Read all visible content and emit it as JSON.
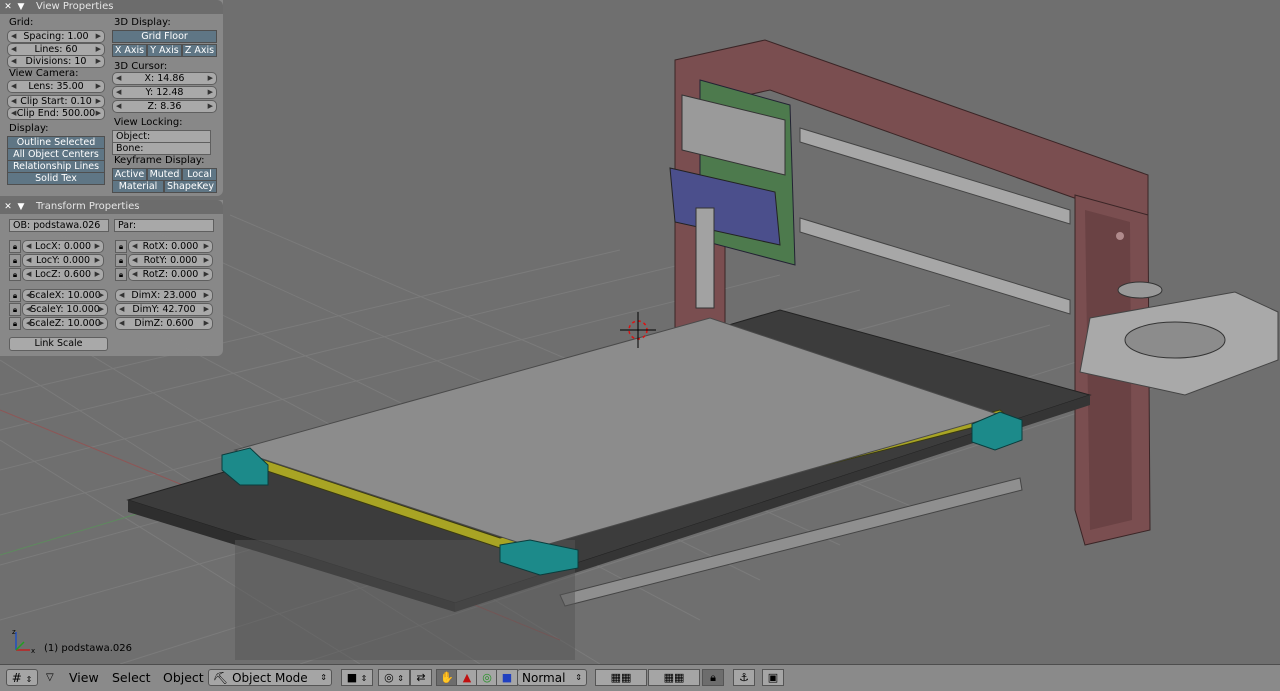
{
  "view_properties": {
    "title": "View Properties",
    "grid": {
      "label": "Grid:",
      "spacing": "Spacing: 1.00",
      "lines": "Lines: 60",
      "divisions": "Divisions: 10"
    },
    "view_camera": {
      "label": "View Camera:",
      "lens": "Lens: 35.00",
      "clip_start": "Clip Start: 0.10",
      "clip_end": "Clip End: 500.00"
    },
    "display": {
      "label": "Display:",
      "items": [
        "Outline Selected",
        "All Object Centers",
        "Relationship Lines",
        "Solid Tex"
      ]
    },
    "display_3d": {
      "label": "3D Display:",
      "grid_floor": "Grid Floor",
      "x_axis": "X Axis",
      "y_axis": "Y Axis",
      "z_axis": "Z Axis"
    },
    "cursor_3d": {
      "label": "3D Cursor:",
      "x": "X: 14.86",
      "y": "Y: 12.48",
      "z": "Z: 8.36"
    },
    "view_locking": {
      "label": "View Locking:",
      "object": "Object:",
      "bone": "Bone:"
    },
    "keyframe_display": {
      "label": "Keyframe Display:",
      "active": "Active",
      "muted": "Muted",
      "local": "Local",
      "material": "Material",
      "shapekey": "ShapeKey"
    }
  },
  "transform_properties": {
    "title": "Transform Properties",
    "object_name": "OB: podstawa.026",
    "parent": "Par:",
    "loc": [
      "LocX: 0.000",
      "LocY: 0.000",
      "LocZ: 0.600"
    ],
    "rot": [
      "RotX: 0.000",
      "RotY: 0.000",
      "RotZ: 0.000"
    ],
    "scale": [
      "ScaleX: 10.000",
      "ScaleY: 10.000",
      "ScaleZ: 10.000"
    ],
    "dim": [
      "DimX: 23.000",
      "DimY: 42.700",
      "DimZ: 0.600"
    ],
    "link_scale": "Link Scale"
  },
  "viewport": {
    "status_text": "(1) podstawa.026",
    "colors": {
      "background": "#6f6f6f",
      "frame": "#7a4e50",
      "plate": "#8c8c8c",
      "base": "#3c3c3c",
      "rail": "#a8a424",
      "corner": "#1c8a8a",
      "carriage": "#4b4f8c",
      "board": "#4d7a4d"
    }
  },
  "header": {
    "menus": [
      "View",
      "Select",
      "Object"
    ],
    "mode": "Object Mode",
    "shading": "Normal",
    "icons": [
      "grid-editor-icon",
      "mode-object-icon",
      "pivot-icon",
      "hand-manipulator-icon",
      "translate-icon",
      "rotate-icon",
      "scale-icon",
      "layer-buttons",
      "lock-icon",
      "render-icon"
    ]
  }
}
